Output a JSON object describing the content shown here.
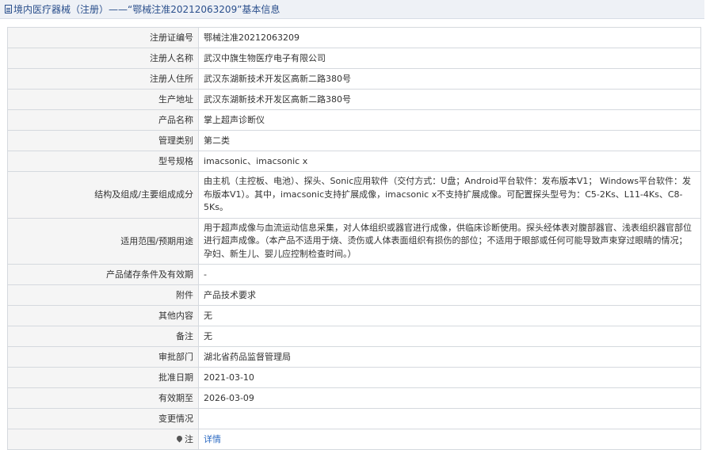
{
  "header": {
    "title": "境内医疗器械（注册）——“鄂械注准20212063209”基本信息"
  },
  "rows": [
    {
      "label": "注册证编号",
      "value": "鄂械注准20212063209"
    },
    {
      "label": "注册人名称",
      "value": "武汉中旗生物医疗电子有限公司"
    },
    {
      "label": "注册人住所",
      "value": "武汉东湖新技术开发区高新二路380号"
    },
    {
      "label": "生产地址",
      "value": "武汉东湖新技术开发区高新二路380号"
    },
    {
      "label": "产品名称",
      "value": "掌上超声诊断仪"
    },
    {
      "label": "管理类别",
      "value": "第二类"
    },
    {
      "label": "型号规格",
      "value": "imacsonic、imacsonic x"
    },
    {
      "label": "结构及组成/主要组成成分",
      "value": "由主机（主控板、电池）、探头、Sonic应用软件（交付方式：U盘；Android平台软件：发布版本V1； Windows平台软件：发布版本V1）。其中，imacsonic支持扩展成像，imacsonic x不支持扩展成像。可配置探头型号为：C5-2Ks、L11-4Ks、C8-5Ks。"
    },
    {
      "label": "适用范围/预期用途",
      "value": "用于超声成像与血流运动信息采集，对人体组织或器官进行成像，供临床诊断使用。探头经体表对腹部器官、浅表组织器官部位进行超声成像。（本产品不适用于烧、烫伤或人体表面组织有损伤的部位；不适用于眼部或任何可能导致声束穿过眼睛的情况；孕妇、新生儿、婴儿应控制检查时间。）"
    },
    {
      "label": "产品储存条件及有效期",
      "value": "-"
    },
    {
      "label": "附件",
      "value": "产品技术要求"
    },
    {
      "label": "其他内容",
      "value": "无"
    },
    {
      "label": "备注",
      "value": "无"
    },
    {
      "label": "审批部门",
      "value": "湖北省药品监督管理局"
    },
    {
      "label": "批准日期",
      "value": "2021-03-10"
    },
    {
      "label": "有效期至",
      "value": "2026-03-09"
    },
    {
      "label": "变更情况",
      "value": ""
    }
  ],
  "note": {
    "label": "注",
    "link": "详情"
  }
}
